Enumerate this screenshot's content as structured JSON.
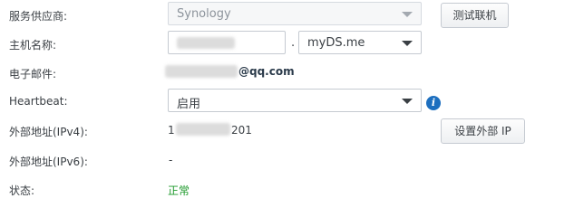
{
  "provider": {
    "label": "服务供应商:",
    "value": "Synology",
    "test_button": "测试联机"
  },
  "hostname": {
    "label": "主机名称:",
    "separator": ".",
    "domain": "myDS.me"
  },
  "email": {
    "label": "电子邮件:",
    "domain_suffix": "@qq.com"
  },
  "heartbeat": {
    "label": "Heartbeat:",
    "value": "启用",
    "info_icon": "info-icon"
  },
  "ipv4": {
    "label": "外部地址(IPv4):",
    "prefix": "1",
    "suffix": "201",
    "set_button": "设置外部 IP"
  },
  "ipv6": {
    "label": "外部地址(IPv6):",
    "value": "-"
  },
  "status": {
    "label": "状态:",
    "value": "正常",
    "color": "#1f9a2c"
  }
}
